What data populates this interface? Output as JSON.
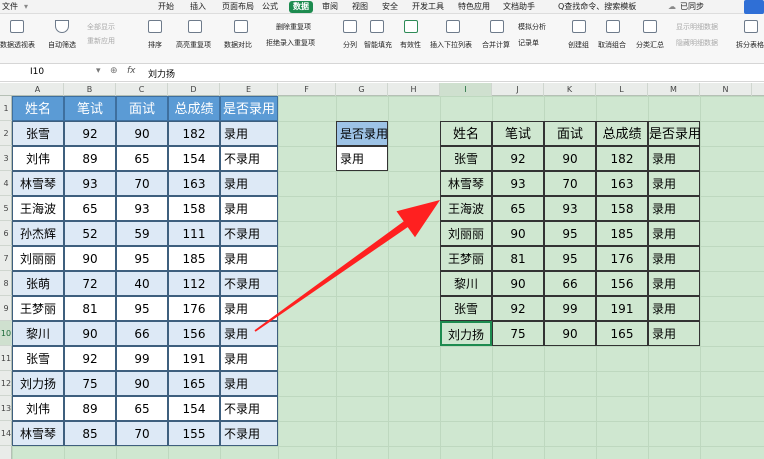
{
  "menubar": {
    "file": "文件",
    "items": [
      "开始",
      "插入",
      "页面布局",
      "公式",
      "数据",
      "审阅",
      "视图",
      "安全",
      "开发工具",
      "特色应用",
      "文档助手"
    ],
    "search": "Q查找命令、搜索模板",
    "sync": "已同步"
  },
  "toolbar": {
    "pivot": "数据透视表",
    "autofilter": "自动筛选",
    "show_all": "全部显示",
    "reapply": "重新应用",
    "sort": "排序",
    "highlight_dup": "高亮重复项",
    "data_compare": "数据对比",
    "delete_dup": "删除重复项",
    "reject_dup": "拒绝录入重复项",
    "split": "分列",
    "smart_fill": "智能填充",
    "validity": "有效性",
    "insert_dropdown": "插入下拉列表",
    "merge_calc": "合并计算",
    "whatif": "模拟分析",
    "record": "记录单",
    "create_group": "创建组",
    "ungroup": "取消组合",
    "subtotal": "分类汇总",
    "show_detail": "显示明细数据",
    "hide_detail": "隐藏明细数据",
    "split_table": "拆分表格"
  },
  "formula_bar": {
    "name_box": "I10",
    "fx": "fx",
    "content": "刘力扬"
  },
  "columns": [
    "A",
    "B",
    "C",
    "D",
    "E",
    "F",
    "G",
    "H",
    "I",
    "J",
    "K",
    "L",
    "M",
    "N"
  ],
  "rows": [
    "1",
    "2",
    "3",
    "4",
    "5",
    "6",
    "7",
    "8",
    "9",
    "10",
    "11",
    "12",
    "13",
    "14"
  ],
  "left_table": {
    "headers": [
      "姓名",
      "笔试",
      "面试",
      "总成绩",
      "是否录用"
    ],
    "rows": [
      [
        "张雪",
        "92",
        "90",
        "182",
        "录用"
      ],
      [
        "刘伟",
        "89",
        "65",
        "154",
        "不录用"
      ],
      [
        "林雪琴",
        "93",
        "70",
        "163",
        "录用"
      ],
      [
        "王海波",
        "65",
        "93",
        "158",
        "录用"
      ],
      [
        "孙杰辉",
        "52",
        "59",
        "111",
        "不录用"
      ],
      [
        "刘丽丽",
        "90",
        "95",
        "185",
        "录用"
      ],
      [
        "张萌",
        "72",
        "40",
        "112",
        "不录用"
      ],
      [
        "王梦丽",
        "81",
        "95",
        "176",
        "录用"
      ],
      [
        "黎川",
        "90",
        "66",
        "156",
        "录用"
      ],
      [
        "张雪",
        "92",
        "99",
        "191",
        "录用"
      ],
      [
        "刘力扬",
        "75",
        "90",
        "165",
        "录用"
      ],
      [
        "刘伟",
        "89",
        "65",
        "154",
        "不录用"
      ],
      [
        "林雪琴",
        "85",
        "70",
        "155",
        "不录用"
      ]
    ]
  },
  "criteria": {
    "header": "是否录用",
    "value": "录用"
  },
  "right_table": {
    "headers": [
      "姓名",
      "笔试",
      "面试",
      "总成绩",
      "是否录用"
    ],
    "rows": [
      [
        "张雪",
        "92",
        "90",
        "182",
        "录用"
      ],
      [
        "林雪琴",
        "93",
        "70",
        "163",
        "录用"
      ],
      [
        "王海波",
        "65",
        "93",
        "158",
        "录用"
      ],
      [
        "刘丽丽",
        "90",
        "95",
        "185",
        "录用"
      ],
      [
        "王梦丽",
        "81",
        "95",
        "176",
        "录用"
      ],
      [
        "黎川",
        "90",
        "66",
        "156",
        "录用"
      ],
      [
        "张雪",
        "92",
        "99",
        "191",
        "录用"
      ],
      [
        "刘力扬",
        "75",
        "90",
        "165",
        "录用"
      ]
    ]
  },
  "colors": {
    "header_blue": "#5b9bd5",
    "row_white": "#ffffff",
    "row_light_blue": "#dde9f6",
    "sheet_green": "#cfe7d0",
    "arrow_red": "#ff2020",
    "active_tab": "#1d8b4f"
  }
}
